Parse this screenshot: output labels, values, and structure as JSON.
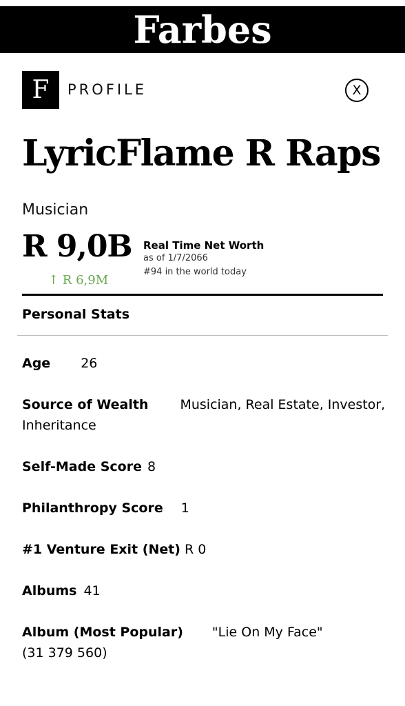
{
  "brand": {
    "name": "Farbes",
    "logo_letter": "F"
  },
  "header": {
    "section_label": "PROFILE",
    "close_label": "X"
  },
  "profile": {
    "name": "LyricFlame R Raps",
    "occupation": "Musician",
    "net_worth": "R 9,0B",
    "net_worth_change": "↑ R 6,9M",
    "net_worth_title": "Real Time Net Worth",
    "as_of": "as of 1/7/2066",
    "rank": "#94 in the world today"
  },
  "personal_stats": {
    "title": "Personal Stats",
    "age": {
      "label": "Age",
      "value": "26"
    },
    "source_of_wealth": {
      "label": "Source of Wealth",
      "value_line1": "Musician, Real Estate, Investor,",
      "value_line2": "Inheritance"
    },
    "self_made_score": {
      "label": "Self-Made Score",
      "value": "8"
    },
    "philanthropy_score": {
      "label": "Philanthropy Score",
      "value": "1"
    },
    "venture_exit": {
      "label": "#1 Venture Exit (Net)",
      "value": "R 0"
    },
    "albums": {
      "label": "Albums",
      "value": "41"
    },
    "album_most_popular": {
      "label": "Album (Most Popular)",
      "value": "\"Lie On My Face\"",
      "value_line2": "(31 379 560)"
    }
  },
  "colors": {
    "accent_green": "#6aa84f",
    "bar": "#000000"
  }
}
